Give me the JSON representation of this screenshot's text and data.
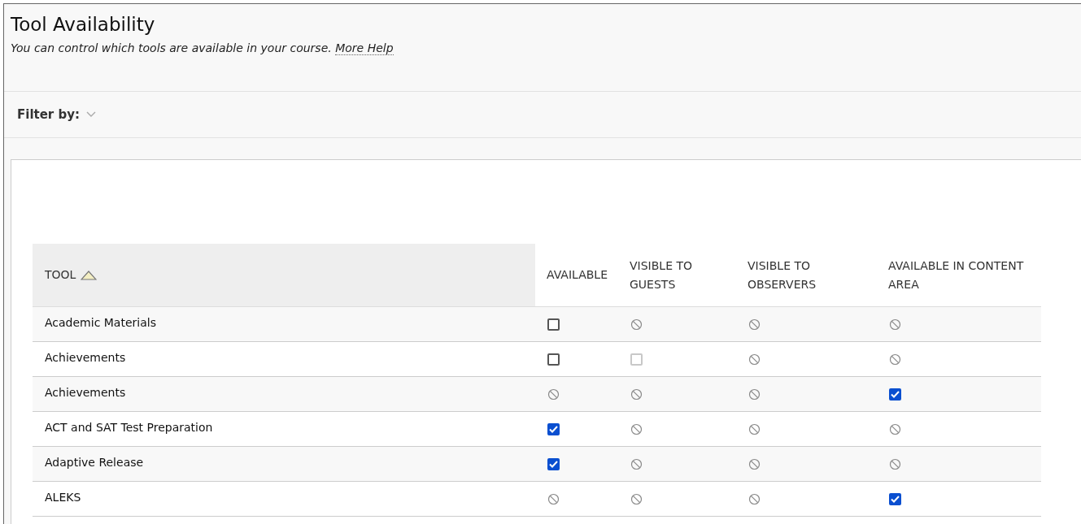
{
  "page": {
    "title": "Tool Availability",
    "description": "You can control which tools are available in your course.",
    "help_link": "More Help"
  },
  "filter": {
    "label": "Filter by:"
  },
  "table": {
    "columns": [
      {
        "label": "TOOL",
        "sorted": true
      },
      {
        "label": "AVAILABLE",
        "sorted": false
      },
      {
        "label": "VISIBLE TO GUESTS",
        "sorted": false
      },
      {
        "label": "VISIBLE TO OBSERVERS",
        "sorted": false
      },
      {
        "label": "AVAILABLE IN CONTENT AREA",
        "sorted": false
      }
    ],
    "rows": [
      {
        "tool": "Academic Materials",
        "cells": [
          {
            "kind": "checkbox",
            "checked": false,
            "disabled": false
          },
          {
            "kind": "blocked"
          },
          {
            "kind": "blocked"
          },
          {
            "kind": "blocked"
          }
        ]
      },
      {
        "tool": "Achievements",
        "cells": [
          {
            "kind": "checkbox",
            "checked": false,
            "disabled": false
          },
          {
            "kind": "checkbox",
            "checked": false,
            "disabled": true
          },
          {
            "kind": "blocked"
          },
          {
            "kind": "blocked"
          }
        ]
      },
      {
        "tool": "Achievements",
        "cells": [
          {
            "kind": "blocked"
          },
          {
            "kind": "blocked"
          },
          {
            "kind": "blocked"
          },
          {
            "kind": "checkbox",
            "checked": true,
            "disabled": false
          }
        ]
      },
      {
        "tool": "ACT and SAT Test Preparation",
        "cells": [
          {
            "kind": "checkbox",
            "checked": true,
            "disabled": false
          },
          {
            "kind": "blocked"
          },
          {
            "kind": "blocked"
          },
          {
            "kind": "blocked"
          }
        ]
      },
      {
        "tool": "Adaptive Release",
        "cells": [
          {
            "kind": "checkbox",
            "checked": true,
            "disabled": false
          },
          {
            "kind": "blocked"
          },
          {
            "kind": "blocked"
          },
          {
            "kind": "blocked"
          }
        ]
      },
      {
        "tool": "ALEKS",
        "cells": [
          {
            "kind": "blocked"
          },
          {
            "kind": "blocked"
          },
          {
            "kind": "blocked"
          },
          {
            "kind": "checkbox",
            "checked": true,
            "disabled": false
          }
        ]
      }
    ]
  }
}
